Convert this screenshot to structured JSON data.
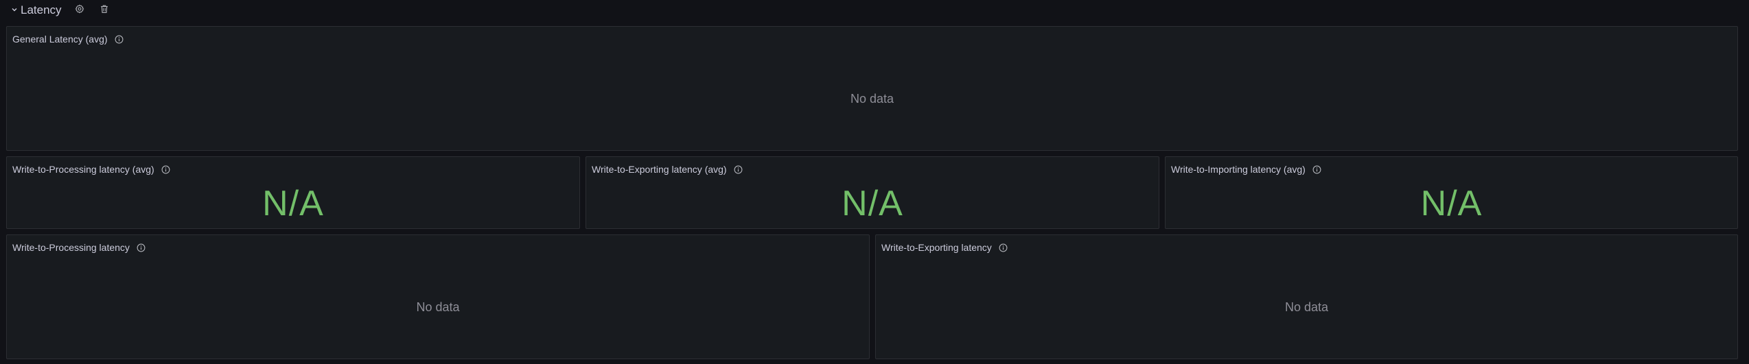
{
  "row": {
    "title": "Latency",
    "icons": {
      "toggle": "chevron-down-icon",
      "settings": "gear-icon",
      "delete": "trash-icon"
    }
  },
  "panels": {
    "general": {
      "title": "General Latency (avg)",
      "message": "No data"
    },
    "stat_processing": {
      "title": "Write-to-Processing latency (avg)",
      "value": "N/A"
    },
    "stat_exporting": {
      "title": "Write-to-Exporting latency (avg)",
      "value": "N/A"
    },
    "stat_importing": {
      "title": "Write-to-Importing latency (avg)",
      "value": "N/A"
    },
    "processing": {
      "title": "Write-to-Processing latency",
      "message": "No data"
    },
    "exporting": {
      "title": "Write-to-Exporting latency",
      "message": "No data"
    }
  },
  "colors": {
    "background": "#111217",
    "panel": "#181b1f",
    "border": "#2c2e33",
    "stat_green": "#73bf69",
    "muted_text": "#8e8e97"
  }
}
